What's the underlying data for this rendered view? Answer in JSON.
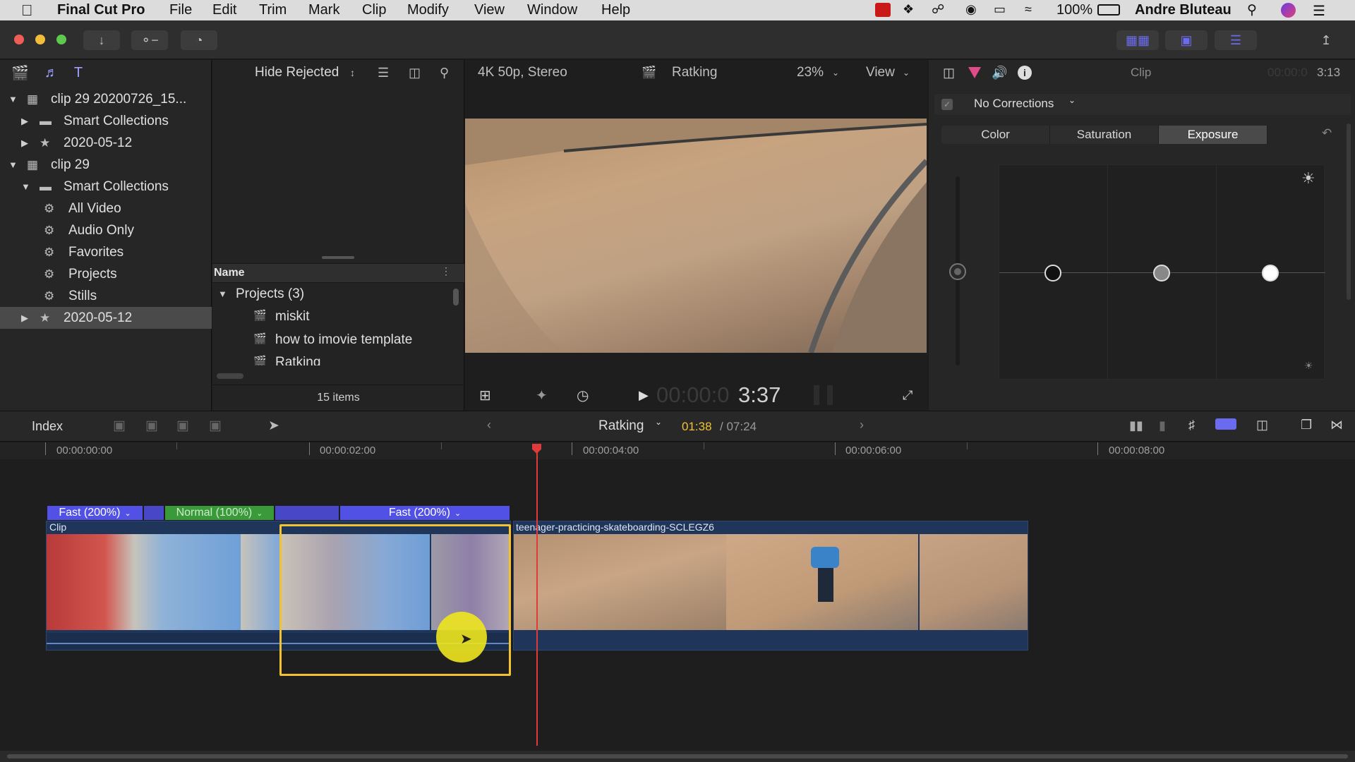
{
  "menubar": {
    "app_name": "Final Cut Pro",
    "items": [
      "File",
      "Edit",
      "Trim",
      "Mark",
      "Clip",
      "Modify",
      "View",
      "Window",
      "Help"
    ],
    "battery": "100%",
    "user": "Andre Bluteau"
  },
  "library": {
    "rows": [
      {
        "label": "clip 29 20200726_15...",
        "level": 0,
        "open": true,
        "icon": "library-icon"
      },
      {
        "label": "Smart Collections",
        "level": 1,
        "open": false,
        "icon": "folder-icon"
      },
      {
        "label": "2020-05-12",
        "level": 1,
        "open": false,
        "icon": "event-icon"
      },
      {
        "label": "clip 29",
        "level": 0,
        "open": true,
        "icon": "library-icon"
      },
      {
        "label": "Smart Collections",
        "level": 1,
        "open": true,
        "icon": "folder-icon"
      },
      {
        "label": "All Video",
        "level": 2,
        "icon": "gear-icon"
      },
      {
        "label": "Audio Only",
        "level": 2,
        "icon": "gear-icon"
      },
      {
        "label": "Favorites",
        "level": 2,
        "icon": "gear-icon"
      },
      {
        "label": "Projects",
        "level": 2,
        "icon": "gear-icon"
      },
      {
        "label": "Stills",
        "level": 2,
        "icon": "gear-icon"
      },
      {
        "label": "2020-05-12",
        "level": 1,
        "open": false,
        "selected": true,
        "icon": "event-icon"
      }
    ]
  },
  "browser": {
    "filter": "Hide Rejected",
    "name_col": "Name",
    "group": "Projects  (3)",
    "items": [
      "miskit",
      "how to imovie template",
      "Ratking"
    ],
    "count": "15 items"
  },
  "viewer": {
    "format": "4K 50p, Stereo",
    "project": "Ratking",
    "zoom": "23%",
    "view": "View",
    "timecode_dim": "00:00:0",
    "timecode_bright": "3:37"
  },
  "inspector": {
    "title": "Clip",
    "time_dim": "00:00:0",
    "time_bright": "3:13",
    "corrections": "No Corrections",
    "tabs": [
      "Color",
      "Saturation",
      "Exposure"
    ],
    "active_tab": "Exposure"
  },
  "timeline_bar": {
    "index": "Index",
    "project": "Ratking",
    "position": "01:38",
    "duration": "/ 07:24"
  },
  "ruler": [
    "00:00:00:00",
    "00:00:02:00",
    "00:00:04:00",
    "00:00:06:00",
    "00:00:08:00"
  ],
  "speeds": [
    {
      "label": "Fast (200%)",
      "color": "#5151e6"
    },
    {
      "label": "Normal (100%)",
      "color": "#3a9a3a"
    },
    {
      "label": "Fast (200%)",
      "color": "#5151e6"
    }
  ],
  "clips": {
    "first_label": "Clip",
    "second_label": "teenager-practicing-skateboarding-SCLEGZ6"
  },
  "colors": {
    "accent": "#7b7bff",
    "selection": "#f2c230",
    "playhead": "#e03b3b"
  }
}
